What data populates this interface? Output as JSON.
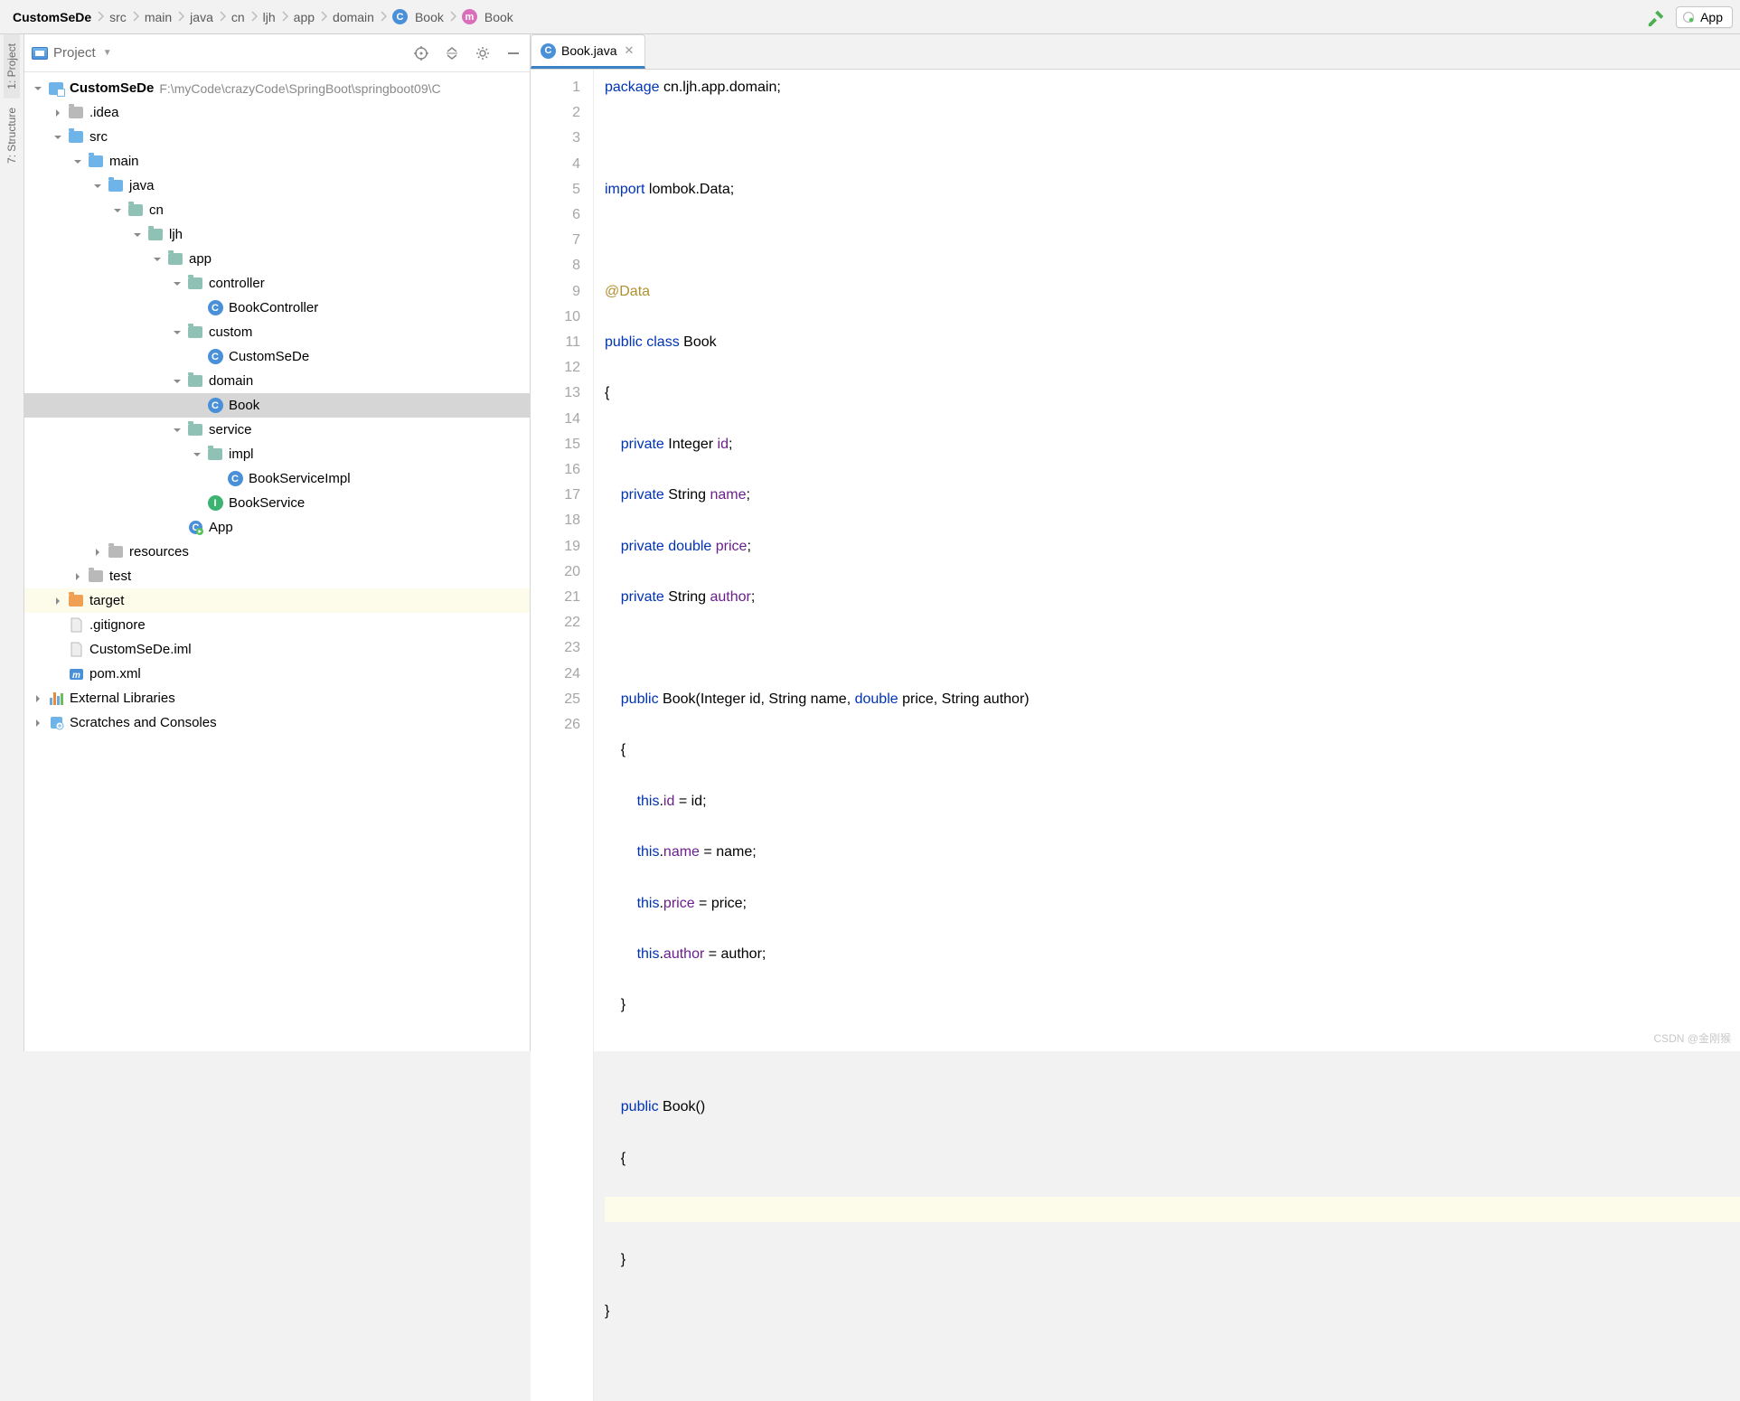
{
  "breadcrumbs": [
    "CustomSeDe",
    "src",
    "main",
    "java",
    "cn",
    "ljh",
    "app",
    "domain",
    "Book",
    "Book"
  ],
  "breadcrumb_icons": {
    "8": "class",
    "9": "method"
  },
  "run_config": "App",
  "sidebar_title": "Project",
  "left_tabs": {
    "project": "1: Project",
    "structure": "7: Structure"
  },
  "tree": {
    "root": {
      "label": "CustomSeDe",
      "sub": "F:\\myCode\\crazyCode\\SpringBoot\\springboot09\\C"
    },
    "idea": ".idea",
    "src": "src",
    "main": "main",
    "java": "java",
    "cn": "cn",
    "ljh": "ljh",
    "app": "app",
    "controller": "controller",
    "BookController": "BookController",
    "custom": "custom",
    "CustomSeDe": "CustomSeDe",
    "domain": "domain",
    "Book": "Book",
    "service": "service",
    "impl": "impl",
    "BookServiceImpl": "BookServiceImpl",
    "BookService": "BookService",
    "App": "App",
    "resources": "resources",
    "test": "test",
    "target": "target",
    "gitignore": ".gitignore",
    "iml": "CustomSeDe.iml",
    "pom": "pom.xml",
    "extlib": "External Libraries",
    "scratches": "Scratches and Consoles"
  },
  "tab": {
    "file": "Book.java"
  },
  "code_lines": [
    {
      "t": "package ",
      "k": "kw",
      "r": "cn.ljh.app.domain;"
    },
    {
      "blank": true
    },
    {
      "t": "import ",
      "k": "kw",
      "r": "lombok.Data;"
    },
    {
      "blank": true
    },
    {
      "ann": "@Data"
    },
    {
      "parts": [
        {
          "t": "public ",
          "c": "kw"
        },
        {
          "t": "class ",
          "c": "kw"
        },
        {
          "t": "Book",
          "c": "cls"
        }
      ]
    },
    {
      "raw": "{"
    },
    {
      "parts": [
        {
          "t": "    "
        },
        {
          "t": "private ",
          "c": "kw"
        },
        {
          "t": "Integer ",
          "c": "cls"
        },
        {
          "t": "id",
          "c": "fld"
        },
        {
          "t": ";"
        }
      ]
    },
    {
      "parts": [
        {
          "t": "    "
        },
        {
          "t": "private ",
          "c": "kw"
        },
        {
          "t": "String ",
          "c": "cls"
        },
        {
          "t": "name",
          "c": "fld"
        },
        {
          "t": ";"
        }
      ]
    },
    {
      "parts": [
        {
          "t": "    "
        },
        {
          "t": "private ",
          "c": "kw"
        },
        {
          "t": "double ",
          "c": "kw"
        },
        {
          "t": "price",
          "c": "fld"
        },
        {
          "t": ";"
        }
      ]
    },
    {
      "parts": [
        {
          "t": "    "
        },
        {
          "t": "private ",
          "c": "kw"
        },
        {
          "t": "String ",
          "c": "cls"
        },
        {
          "t": "author",
          "c": "fld"
        },
        {
          "t": ";"
        }
      ]
    },
    {
      "blank": true
    },
    {
      "parts": [
        {
          "t": "    "
        },
        {
          "t": "public ",
          "c": "kw"
        },
        {
          "t": "Book",
          "c": "cls"
        },
        {
          "t": "(Integer id, String name, "
        },
        {
          "t": "double ",
          "c": "kw"
        },
        {
          "t": "price, String author)"
        }
      ]
    },
    {
      "raw": "    {"
    },
    {
      "parts": [
        {
          "t": "        "
        },
        {
          "t": "this",
          "c": "kw"
        },
        {
          "t": "."
        },
        {
          "t": "id",
          "c": "fld"
        },
        {
          "t": " = id;"
        }
      ]
    },
    {
      "parts": [
        {
          "t": "        "
        },
        {
          "t": "this",
          "c": "kw"
        },
        {
          "t": "."
        },
        {
          "t": "name",
          "c": "fld"
        },
        {
          "t": " = name;"
        }
      ]
    },
    {
      "parts": [
        {
          "t": "        "
        },
        {
          "t": "this",
          "c": "kw"
        },
        {
          "t": "."
        },
        {
          "t": "price",
          "c": "fld"
        },
        {
          "t": " = price;"
        }
      ]
    },
    {
      "parts": [
        {
          "t": "        "
        },
        {
          "t": "this",
          "c": "kw"
        },
        {
          "t": "."
        },
        {
          "t": "author",
          "c": "fld"
        },
        {
          "t": " = author;"
        }
      ]
    },
    {
      "raw": "    }"
    },
    {
      "blank": true
    },
    {
      "parts": [
        {
          "t": "    "
        },
        {
          "t": "public ",
          "c": "kw"
        },
        {
          "t": "Book",
          "c": "cls"
        },
        {
          "t": "()"
        }
      ]
    },
    {
      "raw": "    {"
    },
    {
      "raw": "",
      "hl": true
    },
    {
      "raw": "    }"
    },
    {
      "raw": "}"
    },
    {
      "blank": true
    }
  ],
  "watermark": "CSDN @金刚猴"
}
